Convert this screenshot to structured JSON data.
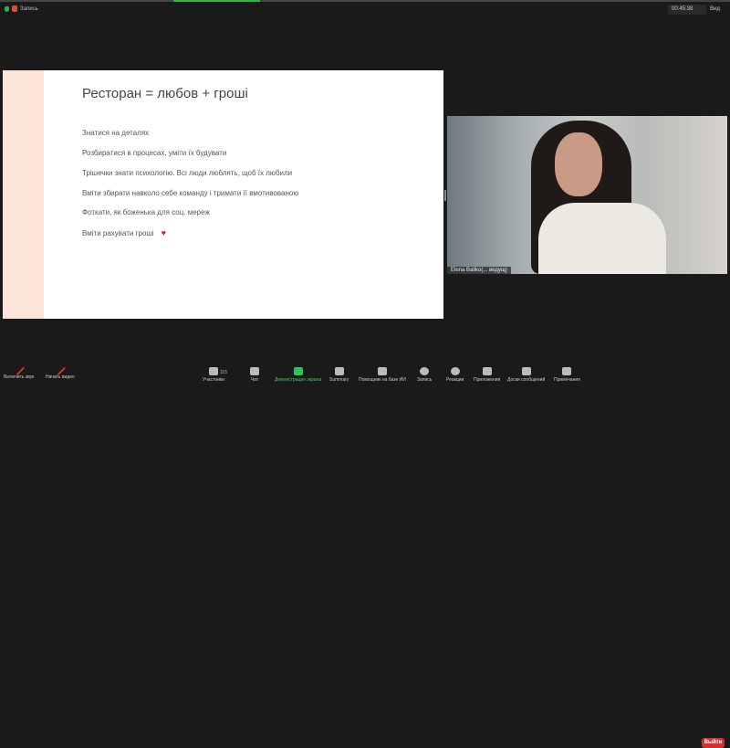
{
  "topbar": {
    "recording_label": "Запись",
    "timer": "00:45:38",
    "view_label": "Вид"
  },
  "slide": {
    "title": "Ресторан = любов + гроші",
    "bullets": [
      "Знатися на деталях",
      "Розбиратися в процесах, уміти їх будувати",
      "Трішечки знати психологію. Всі люди люблять, щоб їх любили",
      "Вміти збирати навколо себе команду і тримати її вмотивованою",
      "Фоткати, як боженька для соц. мереж",
      "Вміти рахувати гроші"
    ],
    "heart": "♥"
  },
  "video": {
    "participant_name": "Elena Baliko(... ведущ)"
  },
  "toolbar": {
    "unmute": "Включить звук",
    "start_video": "Начать видео",
    "participants": "Участники",
    "participants_count": "115",
    "chat": "Чат",
    "share_screen": "Демонстрация экрана",
    "summary": "Summary",
    "ai_companion": "Помощник на базе ИИ",
    "record": "Запись",
    "reactions": "Реакции",
    "apps": "Приложения",
    "whiteboards": "Доски сообщений",
    "notes": "Примечания",
    "leave": "Выйти"
  }
}
